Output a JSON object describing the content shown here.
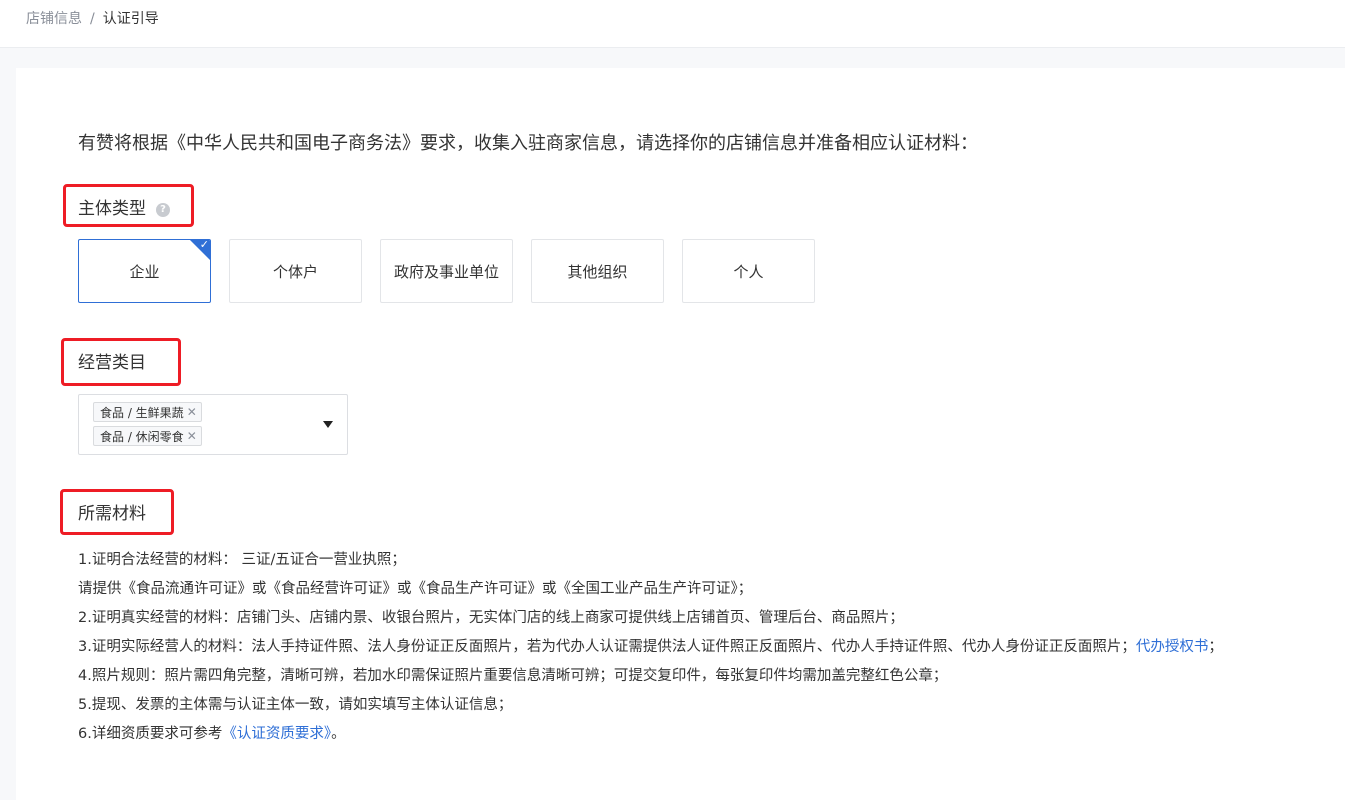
{
  "breadcrumb": {
    "items": [
      "店铺信息",
      "认证引导"
    ],
    "separator": "/"
  },
  "intro": "有赞将根据《中华人民共和国电子商务法》要求，收集入驻商家信息，请选择你的店铺信息并准备相应认证材料：",
  "entity_type": {
    "title": "主体类型",
    "help_icon": "?",
    "options": [
      "企业",
      "个体户",
      "政府及事业单位",
      "其他组织",
      "个人"
    ],
    "selected": "企业",
    "check_mark": "✓"
  },
  "category": {
    "title": "经营类目",
    "tags": [
      "食品 / 生鲜果蔬",
      "食品 / 休闲零食"
    ],
    "tag_close": "✕"
  },
  "materials": {
    "title": "所需材料",
    "item1": "1.证明合法经营的材料： 三证/五证合一营业执照；",
    "item1_note": "请提供《食品流通许可证》或《食品经营许可证》或《食品生产许可证》或《全国工业产品生产许可证》；",
    "item2": "2.证明真实经营的材料：店铺门头、店铺内景、收银台照片，无实体门店的线上商家可提供线上店铺首页、管理后台、商品照片；",
    "item3_text": "3.证明实际经营人的材料：法人手持证件照、法人身份证正反面照片，若为代办人认证需提供法人证件照正反面照片、代办人手持证件照、代办人身份证正反面照片；",
    "item3_link": "代办授权书",
    "item3_end": "；",
    "item4": "4.照片规则：照片需四角完整，清晰可辨，若加水印需保证照片重要信息清晰可辨；可提交复印件，每张复印件均需加盖完整红色公章；",
    "item5": "5.提现、发票的主体需与认证主体一致，请如实填写主体认证信息；",
    "item6_text": "6.详细资质要求可参考",
    "item6_link": "《认证资质要求》",
    "item6_end": "。"
  },
  "colors": {
    "accent": "#2f6fd6",
    "highlight_box": "#ee1c25",
    "background": "#f7f8fa"
  }
}
